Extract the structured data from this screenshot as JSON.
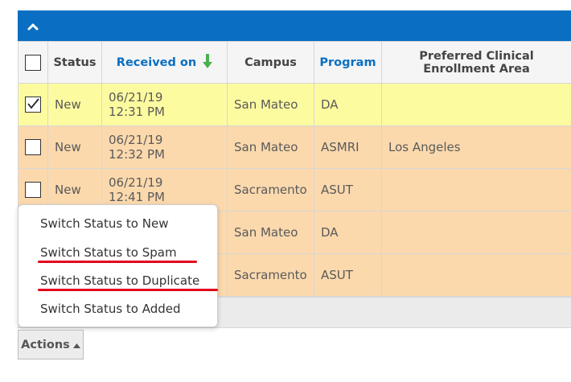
{
  "grid": {
    "columns": [
      "",
      "Status",
      "Received on",
      "Campus",
      "Program",
      "Preferred Clinical Enrollment Area"
    ],
    "rows": [
      {
        "checked": true,
        "status": "New",
        "date": "06/21/19",
        "time": "12:31 PM",
        "campus": "San Mateo",
        "program": "DA",
        "area": ""
      },
      {
        "checked": false,
        "status": "New",
        "date": "06/21/19",
        "time": "12:32 PM",
        "campus": "San Mateo",
        "program": "ASMRI",
        "area": "Los Angeles"
      },
      {
        "checked": false,
        "status": "New",
        "date": "06/21/19",
        "time": "12:41 PM",
        "campus": "Sacramento",
        "program": "ASUT",
        "area": ""
      },
      {
        "checked": false,
        "status": "",
        "date": "",
        "time": "",
        "campus": "San Mateo",
        "program": "DA",
        "area": ""
      },
      {
        "checked": false,
        "status": "",
        "date": "",
        "time": "",
        "campus": "Sacramento",
        "program": "ASUT",
        "area": ""
      }
    ]
  },
  "menu": {
    "items": [
      "Switch Status to New",
      "Switch Status to Spam",
      "Switch Status to Duplicate",
      "Switch Status to Added"
    ]
  },
  "actions": {
    "label": "Actions"
  },
  "colors": {
    "header_blue": "#0a6fc2",
    "selected_row": "#fdfb9f",
    "row_tan": "#fbd9ad",
    "underline_red": "#e3001b",
    "sort_arrow": "#4caf50"
  },
  "icons": {
    "collapse": "chevron-up-icon",
    "sort": "arrow-down-icon",
    "actions_caret": "caret-up-icon"
  }
}
